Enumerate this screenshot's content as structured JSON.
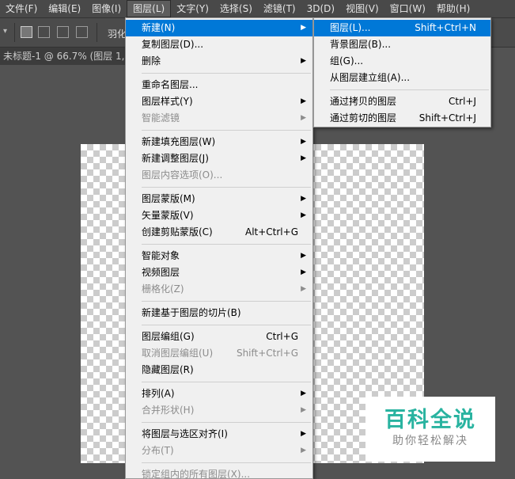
{
  "menubar": {
    "items": [
      {
        "label": "文件(F)"
      },
      {
        "label": "编辑(E)"
      },
      {
        "label": "图像(I)"
      },
      {
        "label": "图层(L)",
        "active": true
      },
      {
        "label": "文字(Y)"
      },
      {
        "label": "选择(S)"
      },
      {
        "label": "滤镜(T)"
      },
      {
        "label": "3D(D)"
      },
      {
        "label": "视图(V)"
      },
      {
        "label": "窗口(W)"
      },
      {
        "label": "帮助(H)"
      }
    ]
  },
  "options_bar": {
    "feather_label": "羽化"
  },
  "document": {
    "tab_title": "未标题-1 @ 66.7% (图层 1, RGB/8)"
  },
  "layer_menu": {
    "items": [
      {
        "label": "新建(N)",
        "shortcut": "",
        "submenu": true,
        "highlighted": true
      },
      {
        "label": "复制图层(D)..."
      },
      {
        "label": "删除",
        "submenu": true
      },
      {
        "separator": true
      },
      {
        "label": "重命名图层..."
      },
      {
        "label": "图层样式(Y)",
        "submenu": true
      },
      {
        "label": "智能滤镜",
        "submenu": true,
        "disabled": true
      },
      {
        "separator": true
      },
      {
        "label": "新建填充图层(W)",
        "submenu": true
      },
      {
        "label": "新建调整图层(J)",
        "submenu": true
      },
      {
        "label": "图层内容选项(O)...",
        "disabled": true
      },
      {
        "separator": true
      },
      {
        "label": "图层蒙版(M)",
        "submenu": true
      },
      {
        "label": "矢量蒙版(V)",
        "submenu": true
      },
      {
        "label": "创建剪贴蒙版(C)",
        "shortcut": "Alt+Ctrl+G"
      },
      {
        "separator": true
      },
      {
        "label": "智能对象",
        "submenu": true
      },
      {
        "label": "视频图层",
        "submenu": true
      },
      {
        "label": "栅格化(Z)",
        "submenu": true,
        "disabled": true
      },
      {
        "separator": true
      },
      {
        "label": "新建基于图层的切片(B)"
      },
      {
        "separator": true
      },
      {
        "label": "图层编组(G)",
        "shortcut": "Ctrl+G"
      },
      {
        "label": "取消图层编组(U)",
        "shortcut": "Shift+Ctrl+G",
        "disabled": true
      },
      {
        "label": "隐藏图层(R)"
      },
      {
        "separator": true
      },
      {
        "label": "排列(A)",
        "submenu": true
      },
      {
        "label": "合并形状(H)",
        "submenu": true,
        "disabled": true
      },
      {
        "separator": true
      },
      {
        "label": "将图层与选区对齐(I)",
        "submenu": true
      },
      {
        "label": "分布(T)",
        "submenu": true,
        "disabled": true
      },
      {
        "separator": true
      },
      {
        "label": "锁定组内的所有图层(X)...",
        "disabled": true
      }
    ]
  },
  "new_submenu": {
    "items": [
      {
        "label": "图层(L)...",
        "shortcut": "Shift+Ctrl+N",
        "highlighted": true
      },
      {
        "label": "背景图层(B)..."
      },
      {
        "label": "组(G)..."
      },
      {
        "label": "从图层建立组(A)..."
      },
      {
        "separator": true
      },
      {
        "label": "通过拷贝的图层",
        "shortcut": "Ctrl+J"
      },
      {
        "label": "通过剪切的图层",
        "shortcut": "Shift+Ctrl+J"
      }
    ]
  },
  "watermark": {
    "title": "百科全说",
    "subtitle": "助你轻松解决"
  },
  "colors": {
    "highlight": "#0078d7",
    "menu_bg": "#f0f0f0",
    "app_bg": "#535353",
    "watermark_green": "#29b3a0"
  },
  "icons": {
    "submenu_arrow": "chevron-right-icon"
  }
}
